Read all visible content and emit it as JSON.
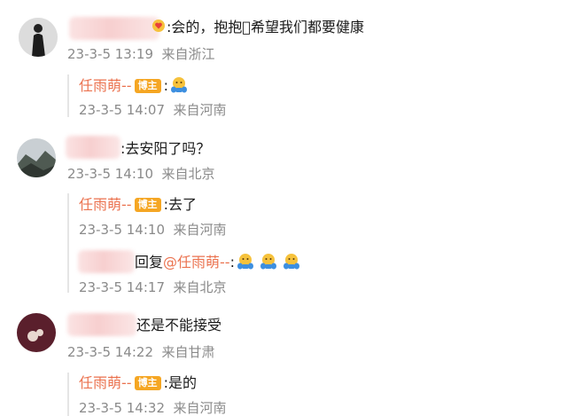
{
  "comments": [
    {
      "text": ":会的，抱抱\u0000希望我们都要健康",
      "time": "23-3-5 13:19",
      "location": "来自浙江",
      "replies": [
        {
          "author": "任雨萌--",
          "badge": "博主",
          "text": ":",
          "time": "23-3-5 14:07",
          "location": "来自河南"
        }
      ]
    },
    {
      "text": ":去安阳了吗？",
      "time": "23-3-5 14:10",
      "location": "来自北京",
      "replies": [
        {
          "author": "任雨萌--",
          "badge": "博主",
          "text": ":去了",
          "time": "23-3-5 14:10",
          "location": "来自河南"
        },
        {
          "reply_word": "回复",
          "mention": "@任雨萌--",
          "text": ":",
          "time": "23-3-5 14:17",
          "location": "来自北京"
        }
      ]
    },
    {
      "text": "还是不能接受",
      "time": "23-3-5 14:22",
      "location": "来自甘肃",
      "replies": [
        {
          "author": "任雨萌--",
          "badge": "博主",
          "text": ":是的",
          "time": "23-3-5 14:32",
          "location": "来自河南"
        }
      ]
    }
  ],
  "colors": {
    "name": "#eb7350",
    "badge": "#f5a623",
    "meta": "#8a8a8a",
    "line": "#e5e5e5"
  },
  "icons": [
    "hug-emoji-icon",
    "heart-icon"
  ]
}
